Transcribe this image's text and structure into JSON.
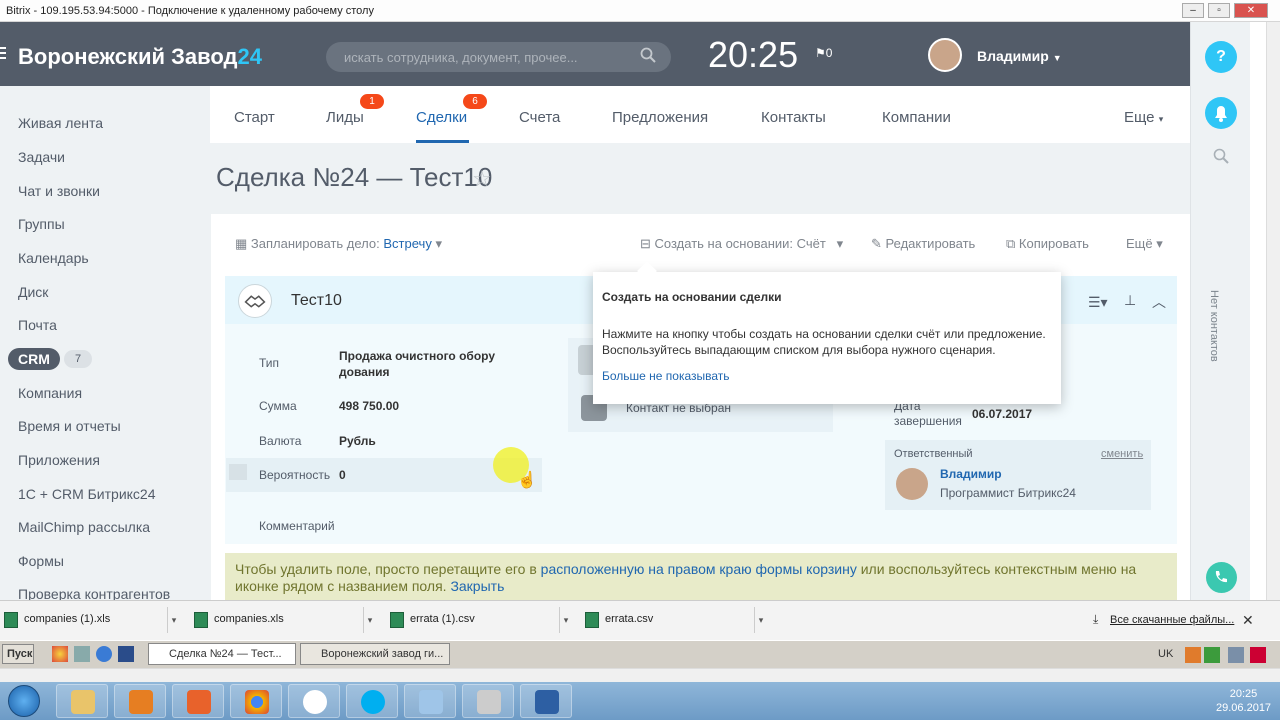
{
  "rdp": {
    "title": "Bitrix - 109.195.53.94:5000 - Подключение к удаленному рабочему столу"
  },
  "header": {
    "logo_main": "Воронежский Завод",
    "logo_num": "24",
    "search_placeholder": "искать сотрудника, документ, прочее...",
    "clock": "20:25",
    "flag_count": "0",
    "user_name": "Владимир"
  },
  "menu": {
    "items": [
      "Живая лента",
      "Задачи",
      "Чат и звонки",
      "Группы",
      "Календарь",
      "Диск",
      "Почта",
      "CRM",
      "Компания",
      "Время и отчеты",
      "Приложения",
      "1С + CRM Битрикс24",
      "MailChimp рассылка",
      "Формы",
      "Проверка контрагентов"
    ],
    "crm_count": "7"
  },
  "tabs": [
    {
      "label": "Старт"
    },
    {
      "label": "Лиды",
      "badge": "1"
    },
    {
      "label": "Сделки",
      "badge": "6"
    },
    {
      "label": "Счета"
    },
    {
      "label": "Предложения"
    },
    {
      "label": "Контакты"
    },
    {
      "label": "Компании"
    },
    {
      "label": "Еще"
    }
  ],
  "page": {
    "title": "Сделка №24 — Тест10"
  },
  "actions": {
    "plan": "Запланировать дело:",
    "plan_value": "Встречу",
    "create": "Создать на основании:",
    "create_value": "Счёт",
    "edit": "Редактировать",
    "copy": "Копировать",
    "more": "Ещё"
  },
  "deal": {
    "name": "Тест10",
    "type_label": "Тип",
    "type_value": "Продажа очистного обору дования",
    "sum_label": "Сумма",
    "sum_value": "498 750.00",
    "currency_label": "Валюта",
    "currency_value": "Рубль",
    "prob_label": "Вероятность",
    "prob_value": "0",
    "comment_label": "Комментарий",
    "contact_empty": "Контакт не выбран",
    "end_label": "Дата завершения",
    "end_value": "06.07.2017",
    "resp_label": "Ответственный",
    "resp_change": "сменить",
    "resp_name": "Владимир",
    "resp_role": "Программист Битрикс24"
  },
  "popup": {
    "title": "Создать на основании сделки",
    "text": "Нажмите на кнопку чтобы создать на основании сделки счёт или предложение. Воспользуйтесь выпадающим списком для выбора нужного сценария.",
    "link": "Больше не показывать"
  },
  "tip": {
    "text1": "Чтобы удалить поле, просто перетащите его в ",
    "link1": "расположенную на правом краю формы корзину",
    "text2": " или воспользуйтесь контекстным меню на иконке рядом с названием поля. ",
    "link2": "Закрыть"
  },
  "right": {
    "no_contacts": "Нет контактов",
    "help": "?"
  },
  "downloads": {
    "files": [
      "companies (1).xls",
      "companies.xls",
      "errata (1).csv",
      "errata.csv"
    ],
    "all": "Все скачанные файлы..."
  },
  "taskbar": {
    "start": "Пуск",
    "btn1": "Сделка №24 — Тест...",
    "btn2": "Воронежский завод ги...",
    "lang": "UK",
    "time": "20:25",
    "date": "29.06.2017"
  }
}
